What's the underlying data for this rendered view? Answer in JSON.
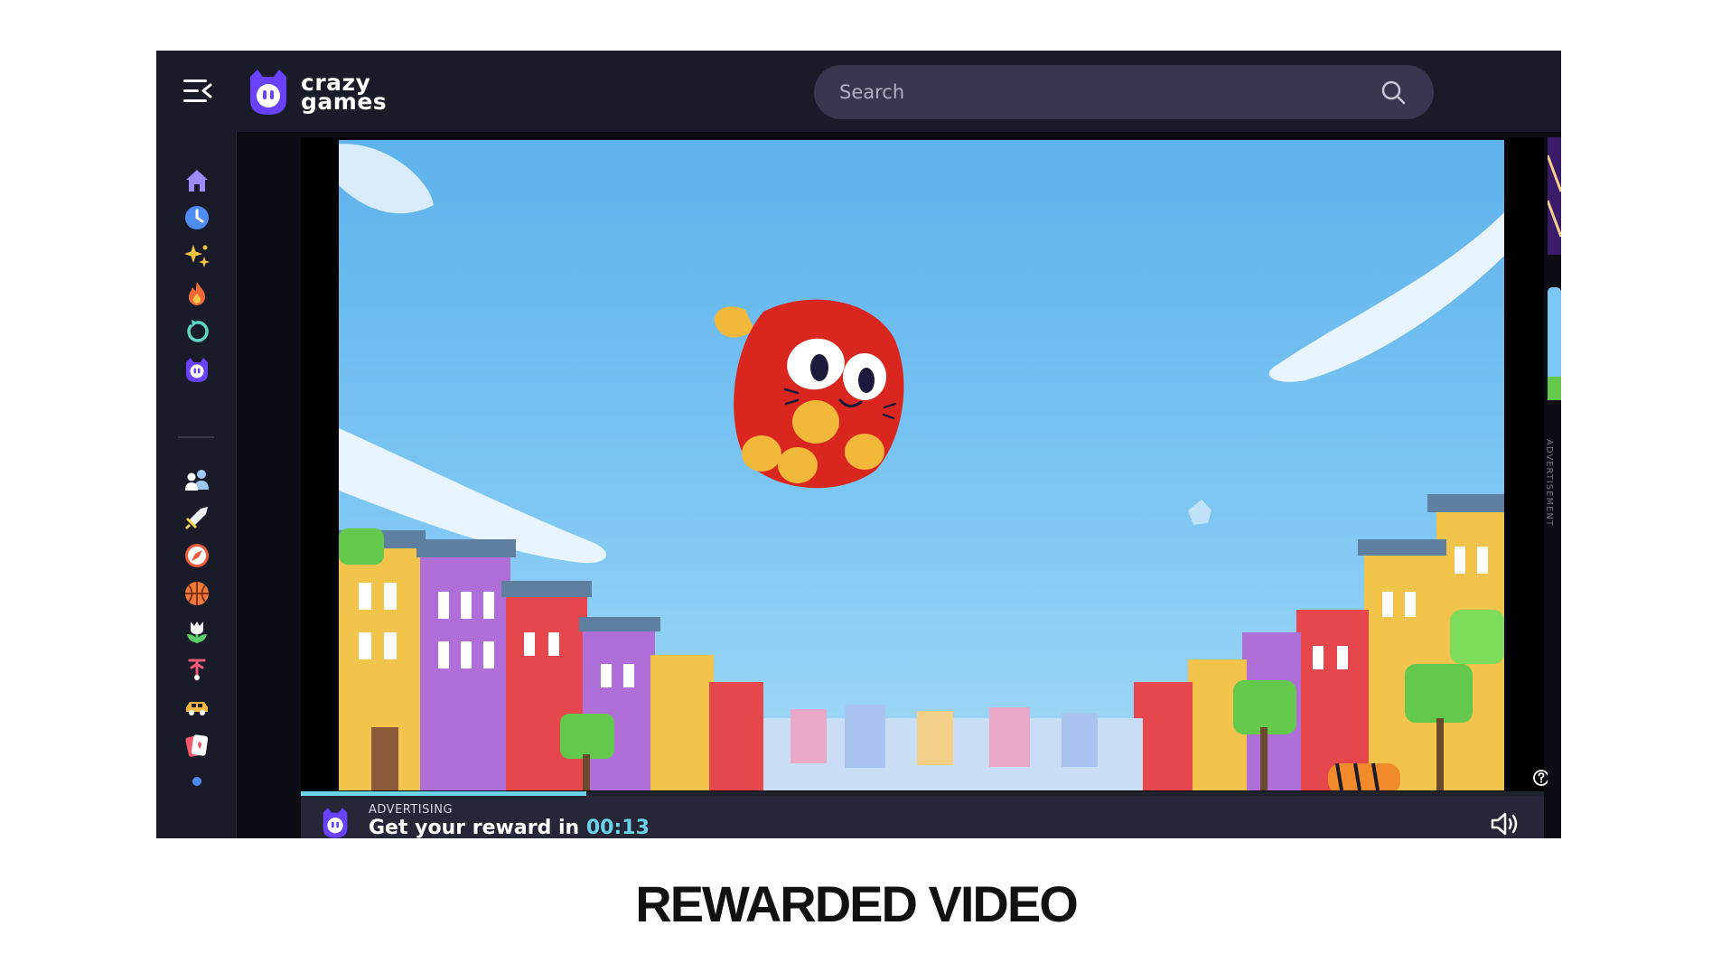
{
  "app": {
    "logo_line1": "crazy",
    "logo_line2": "games"
  },
  "search": {
    "placeholder": "Search"
  },
  "sidebar": {
    "items": [
      {
        "icon": "home-icon",
        "color": "#9b8cff"
      },
      {
        "icon": "clock-icon",
        "color": "#4d8cf0"
      },
      {
        "icon": "sparkles-icon",
        "color": "#f5c542"
      },
      {
        "icon": "fire-icon",
        "color": "#f26a3a"
      },
      {
        "icon": "refresh-icon",
        "color": "#5ed6c4"
      },
      {
        "icon": "crazygames-icon",
        "color": "#6842ff"
      },
      {
        "icon": "people-icon",
        "color": "#9ec9f5"
      },
      {
        "icon": "sword-icon",
        "color": "#f2d34b"
      },
      {
        "icon": "compass-icon",
        "color": "#f05a3a"
      },
      {
        "icon": "basketball-icon",
        "color": "#f07a3a"
      },
      {
        "icon": "flower-icon",
        "color": "#5ed06a"
      },
      {
        "icon": "bicycle-icon",
        "color": "#f05a7a"
      },
      {
        "icon": "car-icon",
        "color": "#f5b642"
      },
      {
        "icon": "cards-icon",
        "color": "#f05a6a"
      },
      {
        "icon": "pin-icon",
        "color": "#4d8cf0"
      }
    ]
  },
  "ad": {
    "label": "ADVERTISING",
    "reward_text": "Get your reward in",
    "countdown": "00:13",
    "progress": 0.23
  },
  "right_ad_label": "ADVERTISEMENT",
  "caption": "REWARDED VIDEO",
  "colors": {
    "brand": "#6842ff",
    "accent": "#6bd3e7",
    "topbar": "#1a1b28"
  }
}
